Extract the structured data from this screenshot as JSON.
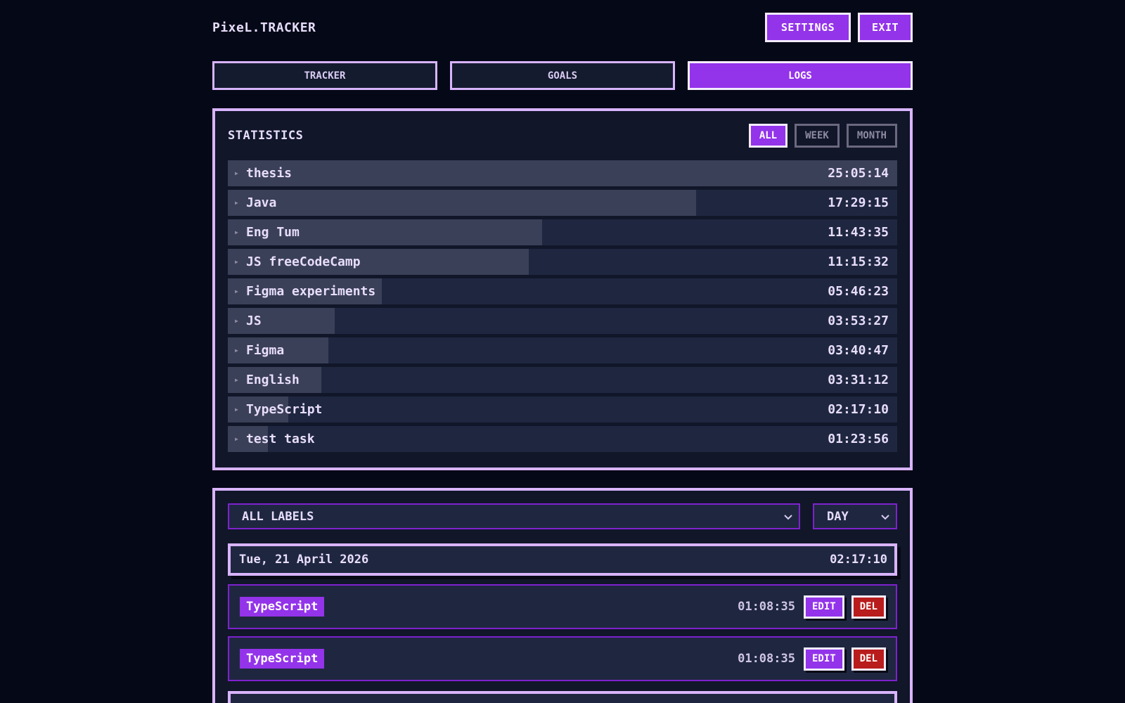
{
  "app": {
    "title": "PixeL.TRACKER"
  },
  "header": {
    "settings_label": "SETTINGS",
    "exit_label": "EXIT"
  },
  "nav": {
    "tabs": [
      {
        "label": "TRACKER",
        "active": false
      },
      {
        "label": "GOALS",
        "active": false
      },
      {
        "label": "LOGS",
        "active": true
      }
    ]
  },
  "statistics": {
    "title": "STATISTICS",
    "filters": [
      {
        "label": "ALL",
        "active": true
      },
      {
        "label": "WEEK",
        "active": false
      },
      {
        "label": "MONTH",
        "active": false
      }
    ],
    "items": [
      {
        "name": "thesis",
        "time": "25:05:14",
        "fill_percent": 100
      },
      {
        "name": "Java",
        "time": "17:29:15",
        "fill_percent": 70
      },
      {
        "name": "Eng Tum",
        "time": "11:43:35",
        "fill_percent": 47
      },
      {
        "name": "JS freeCodeCamp",
        "time": "11:15:32",
        "fill_percent": 45
      },
      {
        "name": "Figma experiments",
        "time": "05:46:23",
        "fill_percent": 23
      },
      {
        "name": "JS",
        "time": "03:53:27",
        "fill_percent": 16
      },
      {
        "name": "Figma",
        "time": "03:40:47",
        "fill_percent": 15
      },
      {
        "name": "English",
        "time": "03:31:12",
        "fill_percent": 14
      },
      {
        "name": "TypeScript",
        "time": "02:17:10",
        "fill_percent": 9
      },
      {
        "name": "test task",
        "time": "01:23:56",
        "fill_percent": 6
      }
    ]
  },
  "logs": {
    "label_filter": "ALL LABELS",
    "period_filter": "DAY",
    "day": {
      "date": "Tue, 21 April 2026",
      "total": "02:17:10"
    },
    "entries": [
      {
        "tag": "TypeScript",
        "time": "01:08:35",
        "edit_label": "EDIT",
        "del_label": "DEL"
      },
      {
        "tag": "TypeScript",
        "time": "01:08:35",
        "edit_label": "EDIT",
        "del_label": "DEL"
      }
    ]
  },
  "colors": {
    "background": "#050816",
    "accent": "#9333ea",
    "panel_border": "#d8b4fe",
    "danger": "#b91c1c"
  }
}
